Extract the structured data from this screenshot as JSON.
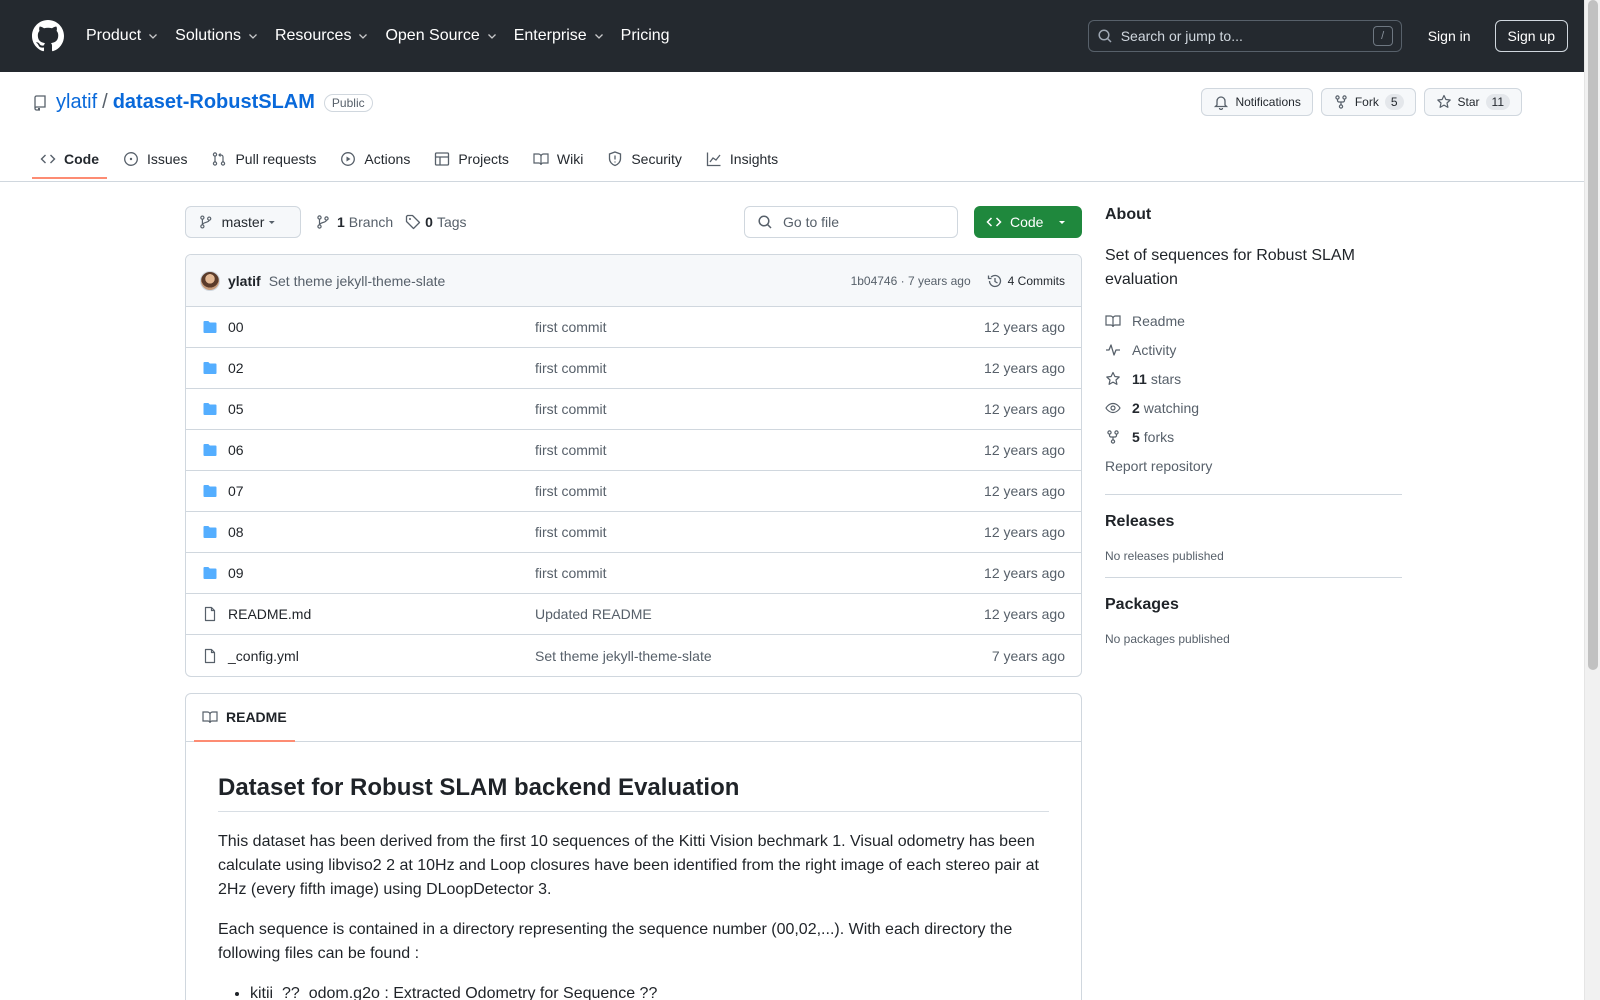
{
  "header": {
    "nav": [
      "Product",
      "Solutions",
      "Resources",
      "Open Source",
      "Enterprise",
      "Pricing"
    ],
    "search_placeholder": "Search or jump to...",
    "search_key": "/",
    "signin": "Sign in",
    "signup": "Sign up"
  },
  "repo": {
    "owner": "ylatif",
    "separator": "/",
    "name": "dataset-RobustSLAM",
    "visibility": "Public",
    "notifications_label": "Notifications",
    "fork_label": "Fork",
    "fork_count": "5",
    "star_label": "Star",
    "star_count": "11"
  },
  "tabs": [
    "Code",
    "Issues",
    "Pull requests",
    "Actions",
    "Projects",
    "Wiki",
    "Security",
    "Insights"
  ],
  "toolbar": {
    "branch": "master",
    "branch_count": "1",
    "branch_label": "Branch",
    "tag_count": "0",
    "tag_label": "Tags",
    "goto_placeholder": "Go to file",
    "code_label": "Code"
  },
  "commit": {
    "author": "ylatif",
    "message": "Set theme jekyll-theme-slate",
    "hash_time": "1b04746 · 7 years ago",
    "commits_label": "4 Commits"
  },
  "files": [
    {
      "name": "00",
      "type": "dir",
      "message": "first commit",
      "date": "12 years ago"
    },
    {
      "name": "02",
      "type": "dir",
      "message": "first commit",
      "date": "12 years ago"
    },
    {
      "name": "05",
      "type": "dir",
      "message": "first commit",
      "date": "12 years ago"
    },
    {
      "name": "06",
      "type": "dir",
      "message": "first commit",
      "date": "12 years ago"
    },
    {
      "name": "07",
      "type": "dir",
      "message": "first commit",
      "date": "12 years ago"
    },
    {
      "name": "08",
      "type": "dir",
      "message": "first commit",
      "date": "12 years ago"
    },
    {
      "name": "09",
      "type": "dir",
      "message": "first commit",
      "date": "12 years ago"
    },
    {
      "name": "README.md",
      "type": "file",
      "message": "Updated README",
      "date": "12 years ago"
    },
    {
      "name": "_config.yml",
      "type": "file",
      "message": "Set theme jekyll-theme-slate",
      "date": "7 years ago"
    }
  ],
  "readme": {
    "tab_label": "README",
    "title": "Dataset for Robust SLAM backend Evaluation",
    "p1": "This dataset has been derived from the first 10 sequences of the Kitti Vision bechmark 1. Visual odometry has been calculate using libviso2 2 at 10Hz and Loop closures have been identified from the right image of each stereo pair at 2Hz (every fifth image) using DLoopDetector 3.",
    "p2": "Each sequence is contained in a directory representing the sequence number (00,02,...). With each directory the following files can be found :",
    "li1": "kitii_??_odom.g2o : Extracted Odometry for Sequence ??"
  },
  "about": {
    "heading": "About",
    "description": "Set of sequences for Robust SLAM evaluation",
    "readme": "Readme",
    "activity": "Activity",
    "stars_count": "11",
    "stars_label": "stars",
    "watching_count": "2",
    "watching_label": "watching",
    "forks_count": "5",
    "forks_label": "forks",
    "report": "Report repository"
  },
  "releases": {
    "heading": "Releases",
    "text": "No releases published"
  },
  "packages": {
    "heading": "Packages",
    "text": "No packages published"
  }
}
